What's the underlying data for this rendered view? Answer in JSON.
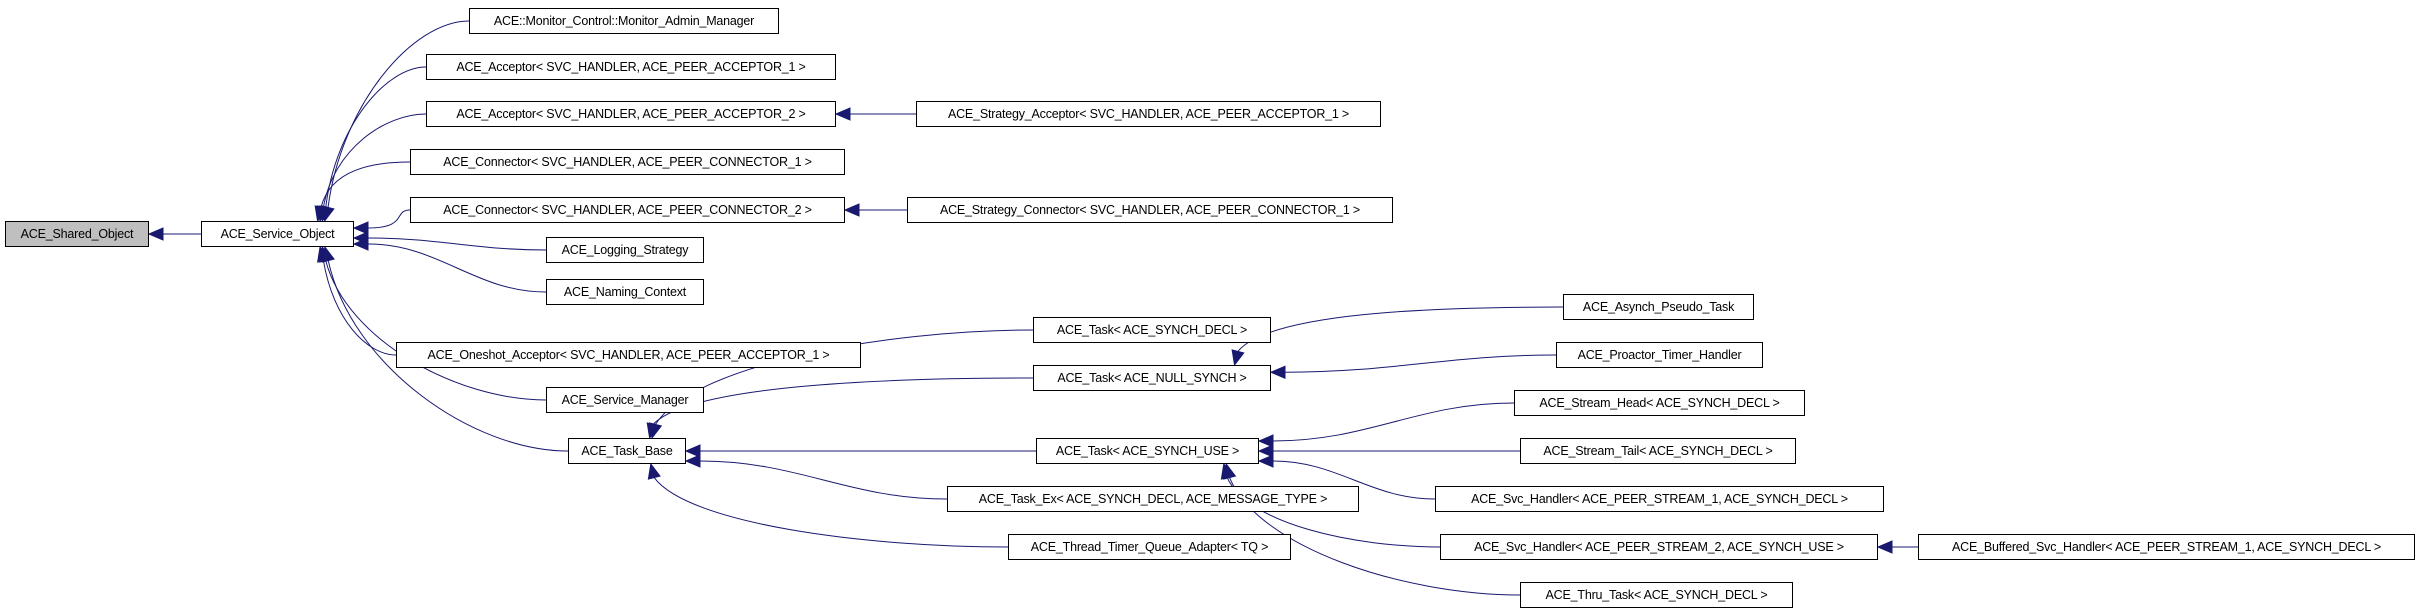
{
  "colors": {
    "edge": "#191970",
    "root_fill": "#bfbfbf",
    "node_fill": "#ffffff"
  },
  "nodes": [
    {
      "id": "shared",
      "label": "ACE_Shared_Object"
    },
    {
      "id": "service",
      "label": "ACE_Service_Object"
    },
    {
      "id": "monitor",
      "label": "ACE::Monitor_Control::Monitor_Admin_Manager"
    },
    {
      "id": "acc1",
      "label": "ACE_Acceptor< SVC_HANDLER, ACE_PEER_ACCEPTOR_1 >"
    },
    {
      "id": "acc2",
      "label": "ACE_Acceptor< SVC_HANDLER, ACE_PEER_ACCEPTOR_2 >"
    },
    {
      "id": "stracc",
      "label": "ACE_Strategy_Acceptor< SVC_HANDLER, ACE_PEER_ACCEPTOR_1 >"
    },
    {
      "id": "con1",
      "label": "ACE_Connector< SVC_HANDLER, ACE_PEER_CONNECTOR_1 >"
    },
    {
      "id": "con2",
      "label": "ACE_Connector< SVC_HANDLER, ACE_PEER_CONNECTOR_2 >"
    },
    {
      "id": "strcon",
      "label": "ACE_Strategy_Connector< SVC_HANDLER, ACE_PEER_CONNECTOR_1 >"
    },
    {
      "id": "logging",
      "label": "ACE_Logging_Strategy"
    },
    {
      "id": "naming",
      "label": "ACE_Naming_Context"
    },
    {
      "id": "oneshot",
      "label": "ACE_Oneshot_Acceptor< SVC_HANDLER, ACE_PEER_ACCEPTOR_1 >"
    },
    {
      "id": "svcmgr",
      "label": "ACE_Service_Manager"
    },
    {
      "id": "taskbase",
      "label": "ACE_Task_Base"
    },
    {
      "id": "taskdecl",
      "label": "ACE_Task< ACE_SYNCH_DECL >"
    },
    {
      "id": "tasknull",
      "label": "ACE_Task< ACE_NULL_SYNCH >"
    },
    {
      "id": "taskuse",
      "label": "ACE_Task< ACE_SYNCH_USE >"
    },
    {
      "id": "taskex",
      "label": "ACE_Task_Ex< ACE_SYNCH_DECL, ACE_MESSAGE_TYPE >"
    },
    {
      "id": "ttqa",
      "label": "ACE_Thread_Timer_Queue_Adapter< TQ >"
    },
    {
      "id": "asynch",
      "label": "ACE_Asynch_Pseudo_Task"
    },
    {
      "id": "proactor",
      "label": "ACE_Proactor_Timer_Handler"
    },
    {
      "id": "shead",
      "label": "ACE_Stream_Head< ACE_SYNCH_DECL >"
    },
    {
      "id": "stail",
      "label": "ACE_Stream_Tail< ACE_SYNCH_DECL >"
    },
    {
      "id": "svch1",
      "label": "ACE_Svc_Handler< ACE_PEER_STREAM_1, ACE_SYNCH_DECL >"
    },
    {
      "id": "svch2",
      "label": "ACE_Svc_Handler< ACE_PEER_STREAM_2, ACE_SYNCH_USE >"
    },
    {
      "id": "buffered",
      "label": "ACE_Buffered_Svc_Handler< ACE_PEER_STREAM_1, ACE_SYNCH_DECL >"
    },
    {
      "id": "thru",
      "label": "ACE_Thru_Task< ACE_SYNCH_DECL >"
    }
  ],
  "root": "shared",
  "edges": [
    [
      "service",
      "shared"
    ],
    [
      "monitor",
      "service"
    ],
    [
      "acc1",
      "service"
    ],
    [
      "acc2",
      "service"
    ],
    [
      "con1",
      "service"
    ],
    [
      "con2",
      "service"
    ],
    [
      "logging",
      "service"
    ],
    [
      "naming",
      "service"
    ],
    [
      "oneshot",
      "service"
    ],
    [
      "svcmgr",
      "service"
    ],
    [
      "taskbase",
      "service"
    ],
    [
      "stracc",
      "acc2"
    ],
    [
      "strcon",
      "con2"
    ],
    [
      "taskdecl",
      "taskbase"
    ],
    [
      "tasknull",
      "taskbase"
    ],
    [
      "taskuse",
      "taskbase"
    ],
    [
      "taskex",
      "taskbase"
    ],
    [
      "ttqa",
      "taskbase"
    ],
    [
      "asynch",
      "tasknull"
    ],
    [
      "proactor",
      "tasknull"
    ],
    [
      "shead",
      "taskuse"
    ],
    [
      "stail",
      "taskuse"
    ],
    [
      "svch1",
      "taskuse"
    ],
    [
      "svch2",
      "taskuse"
    ],
    [
      "thru",
      "taskuse"
    ],
    [
      "buffered",
      "svch2"
    ]
  ]
}
